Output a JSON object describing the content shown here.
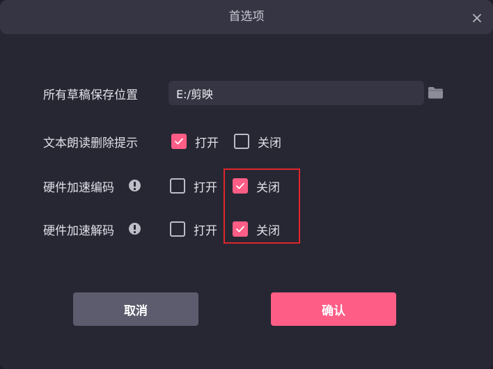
{
  "window": {
    "title": "首选项"
  },
  "settings": {
    "draft_location": {
      "label": "所有草稿保存位置",
      "value": "E:/剪映"
    },
    "tts_delete_prompt": {
      "label": "文本朗读删除提示",
      "on_label": "打开",
      "off_label": "关闭",
      "on_checked": true,
      "off_checked": false
    },
    "hw_encode": {
      "label": "硬件加速编码",
      "on_label": "打开",
      "off_label": "关闭",
      "on_checked": false,
      "off_checked": true
    },
    "hw_decode": {
      "label": "硬件加速解码",
      "on_label": "打开",
      "off_label": "关闭",
      "on_checked": false,
      "off_checked": true
    }
  },
  "buttons": {
    "cancel": "取消",
    "confirm": "确认"
  },
  "colors": {
    "accent": "#fe5d86",
    "background": "#272733",
    "titlebar": "#353544",
    "cancel_button": "#5c5c6e",
    "highlight_box": "#e0262b"
  },
  "icons": [
    "close-icon",
    "folder-icon",
    "info-icon",
    "checkmark-icon"
  ]
}
